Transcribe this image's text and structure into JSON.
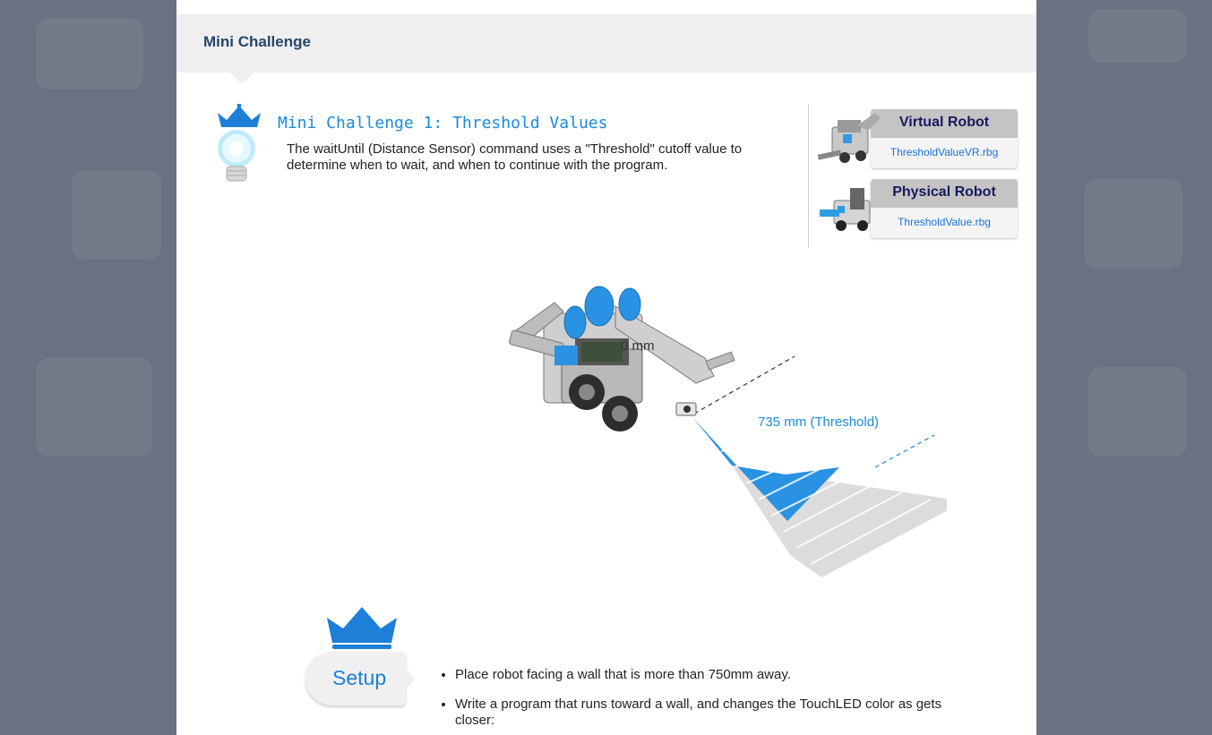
{
  "header": {
    "title": "Mini Challenge"
  },
  "challenge": {
    "title": "Mini Challenge 1: Threshold Values",
    "description": "The waitUntil (Distance Sensor) command uses a \"Threshold\" cutoff value to determine when to wait, and when to continue with the program."
  },
  "robots": [
    {
      "heading": "Virtual Robot",
      "file": "ThresholdValueVR.rbg"
    },
    {
      "heading": "Physical Robot",
      "file": "ThresholdValue.rbg"
    }
  ],
  "diagram": {
    "label_zero": "0 mm",
    "label_threshold": "735 mm (Threshold)"
  },
  "setup": {
    "label": "Setup",
    "items": [
      "Place robot facing a wall that is more than 750mm away.",
      "Write a program that runs toward a wall, and changes the TouchLED color as gets closer:"
    ]
  },
  "colors": {
    "accent_blue": "#1a8ae0",
    "header_text": "#24466b",
    "robot_heading": "#151a5e",
    "link": "#1a73d9"
  },
  "icons": [
    "crown-icon",
    "lightbulb-icon",
    "robot-thumbnail",
    "setup-crown-icon"
  ]
}
